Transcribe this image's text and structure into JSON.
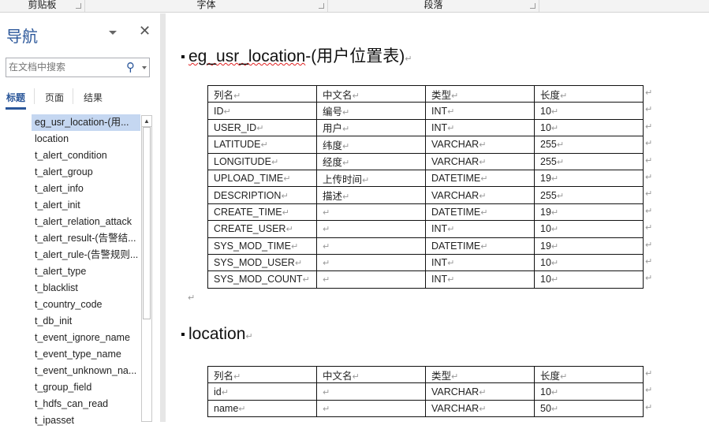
{
  "ribbon": {
    "groups": [
      "剪贴板",
      "字体",
      "段落"
    ]
  },
  "nav": {
    "title": "导航",
    "search_placeholder": "在文档中搜索",
    "tabs": [
      "标题",
      "页面",
      "结果"
    ],
    "items": [
      "eg_usr_location-(用...",
      "location",
      "t_alert_condition",
      "t_alert_group",
      "t_alert_info",
      "t_alert_init",
      "t_alert_relation_attack",
      "t_alert_result-(告警结...",
      "t_alert_rule-(告警规则...",
      "t_alert_type",
      "t_blacklist",
      "t_country_code",
      "t_db_init",
      "t_event_ignore_name",
      "t_event_type_name",
      "t_event_unknown_na...",
      "t_group_field",
      "t_hdfs_can_read",
      "t_ipasset"
    ]
  },
  "doc": {
    "mark": "↵",
    "sections": [
      {
        "heading_main": "eg_usr_location",
        "heading_rest": "-(用户位置表)",
        "header": [
          "列名",
          "中文名",
          "类型",
          "长度"
        ],
        "rows": [
          [
            "ID",
            "编号",
            "INT",
            "10"
          ],
          [
            "USER_ID",
            "用户",
            "INT",
            "10"
          ],
          [
            "LATITUDE",
            "纬度",
            "VARCHAR",
            "255"
          ],
          [
            "LONGITUDE",
            "经度",
            "VARCHAR",
            "255"
          ],
          [
            "UPLOAD_TIME",
            "上传时间",
            "DATETIME",
            "19"
          ],
          [
            "DESCRIPTION",
            "描述",
            "VARCHAR",
            "255"
          ],
          [
            "CREATE_TIME",
            "",
            "DATETIME",
            "19"
          ],
          [
            "CREATE_USER",
            "",
            "INT",
            "10"
          ],
          [
            "SYS_MOD_TIME",
            "",
            "DATETIME",
            "19"
          ],
          [
            "SYS_MOD_USER",
            "",
            "INT",
            "10"
          ],
          [
            "SYS_MOD_COUNT",
            "",
            "INT",
            "10"
          ]
        ]
      },
      {
        "heading_main": "location",
        "heading_rest": "",
        "header": [
          "列名",
          "中文名",
          "类型",
          "长度"
        ],
        "rows": [
          [
            "id",
            "",
            "VARCHAR",
            "10"
          ],
          [
            "name",
            "",
            "VARCHAR",
            "50"
          ]
        ]
      }
    ]
  }
}
